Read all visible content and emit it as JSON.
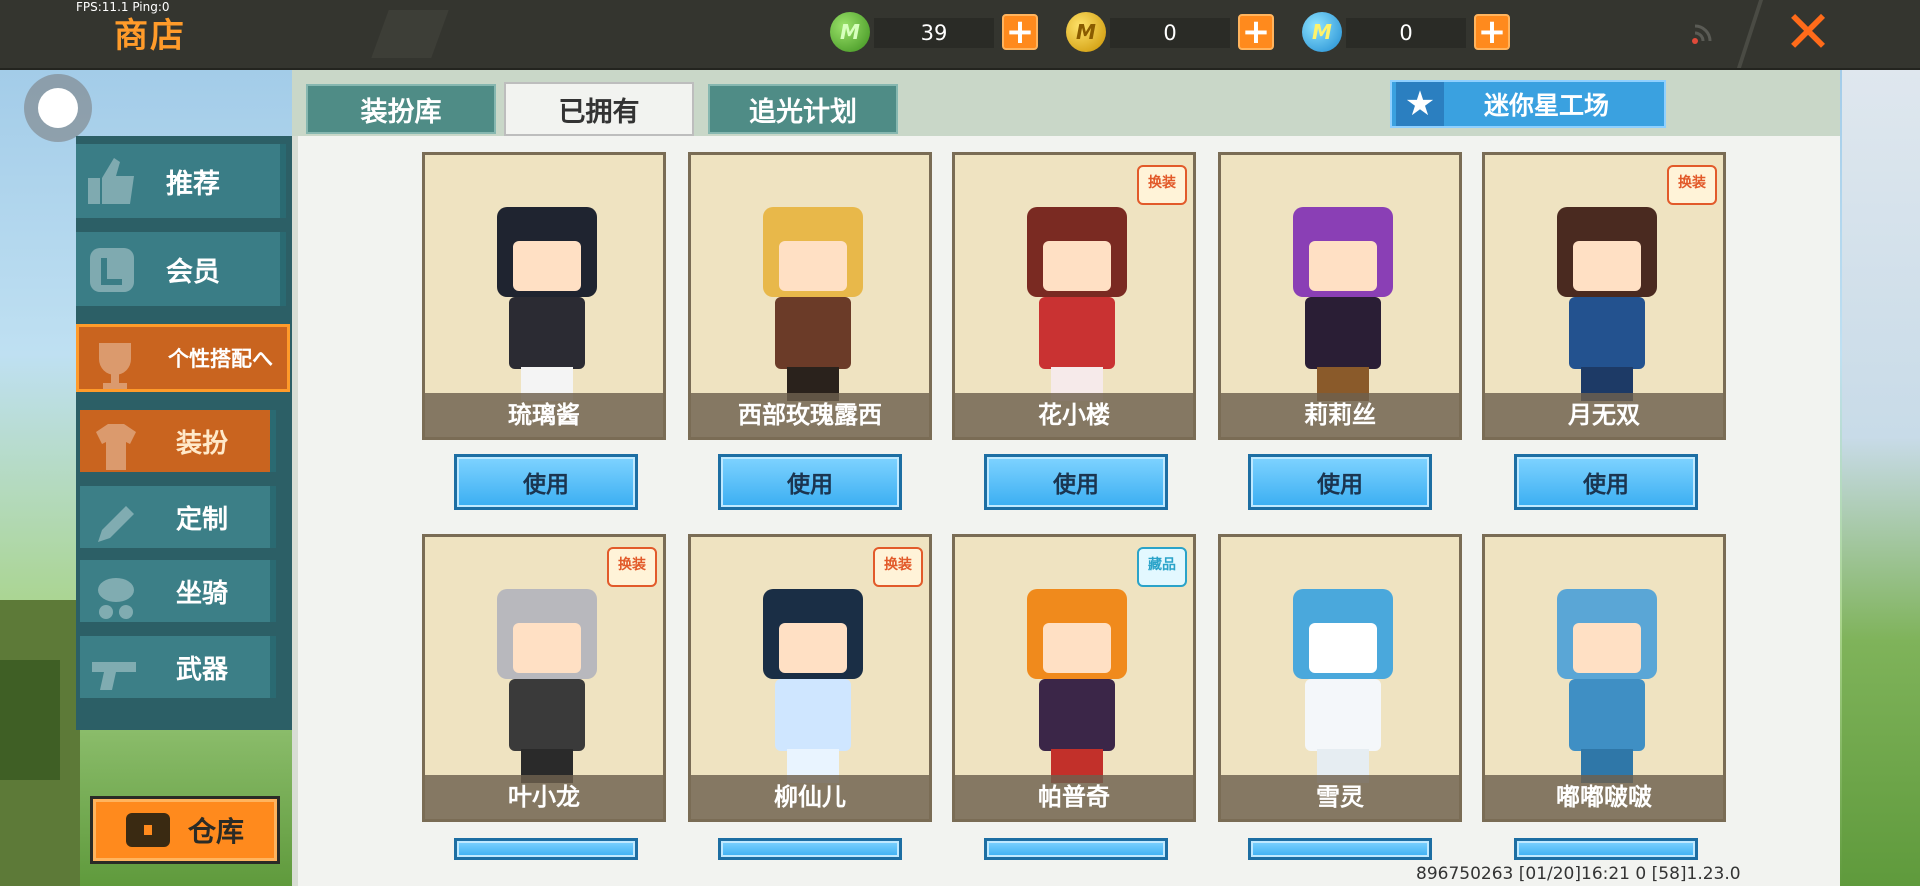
{
  "debug": {
    "fps_text": "FPS:11.1  Ping:0"
  },
  "header": {
    "title": "商店",
    "currencies": [
      {
        "icon": "green-coin-icon",
        "letter": "M",
        "value": "39"
      },
      {
        "icon": "gold-coin-icon",
        "letter": "M",
        "value": "0"
      },
      {
        "icon": "blue-coin-icon",
        "letter": "M",
        "value": "0"
      }
    ],
    "plus_label": "+",
    "close_label": "✕"
  },
  "tabs": [
    {
      "label": "装扮库",
      "active": false
    },
    {
      "label": "已拥有",
      "active": true
    },
    {
      "label": "追光计划",
      "active": false
    }
  ],
  "workshop": {
    "label": "迷你星工场",
    "icon": "star-icon"
  },
  "sidebar": {
    "items": [
      {
        "label": "推荐",
        "icon": "thumbs-up-icon"
      },
      {
        "label": "会员",
        "icon": "member-icon"
      },
      {
        "label": "个性搭配へ",
        "icon": "trophy-icon"
      },
      {
        "label": "装扮",
        "icon": "shirt-icon",
        "active": true
      },
      {
        "label": "定制",
        "icon": "pencil-icon"
      },
      {
        "label": "坐骑",
        "icon": "mount-icon"
      },
      {
        "label": "武器",
        "icon": "pistol-icon"
      }
    ],
    "warehouse_label": "仓库"
  },
  "cards": [
    {
      "name": "琉璃酱",
      "badge": ""
    },
    {
      "name": "西部玫瑰露西",
      "badge": ""
    },
    {
      "name": "花小楼",
      "badge": "换装"
    },
    {
      "name": "莉莉丝",
      "badge": ""
    },
    {
      "name": "月无双",
      "badge": "换装"
    },
    {
      "name": "叶小龙",
      "badge": "换装"
    },
    {
      "name": "柳仙儿",
      "badge": "换装"
    },
    {
      "name": "帕普奇",
      "badge": "藏品"
    },
    {
      "name": "雪灵",
      "badge": ""
    },
    {
      "name": "嘟嘟啵啵",
      "badge": ""
    }
  ],
  "use_label": "使用",
  "footer": {
    "info": "896750263    [01/20]16:21 0    [58]1.23.0"
  },
  "colors": {
    "accent_orange": "#ff8a1d",
    "teal": "#3a7d86",
    "use_blue": "#3aaef2"
  }
}
